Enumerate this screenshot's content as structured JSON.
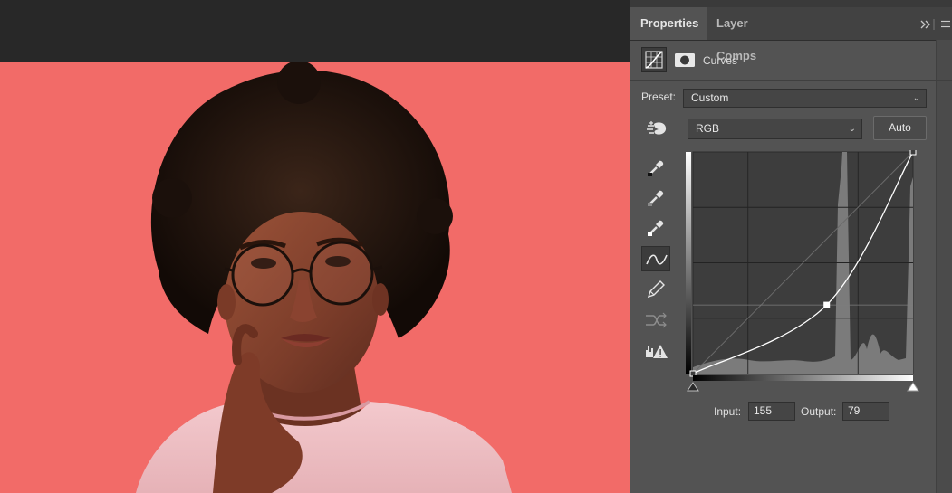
{
  "tabs": [
    {
      "label": "Properties",
      "active": true
    },
    {
      "label": "Layer Comps",
      "active": false
    }
  ],
  "panel": {
    "title": "Curves",
    "preset_label": "Preset:",
    "preset_value": "Custom",
    "channel_value": "RGB",
    "auto_label": "Auto",
    "input_label": "Input:",
    "input_value": "155",
    "output_label": "Output:",
    "output_value": "79"
  },
  "icons": {
    "tab_collapse": "double-chevron-right-icon",
    "tab_menu": "hamburger-menu-icon",
    "adjustment": "curves-adjustment-icon",
    "mask": "layer-mask-icon",
    "on_image": "on-image-adjust-icon",
    "black_point": "black-point-eyedropper-icon",
    "gray_point": "gray-point-eyedropper-icon",
    "white_point": "white-point-eyedropper-icon",
    "edit_points": "edit-points-curve-icon",
    "draw_curve": "pencil-icon",
    "smooth": "smooth-curve-icon",
    "clipping": "clipping-warning-icon"
  },
  "curve": {
    "points": [
      [
        0,
        0
      ],
      [
        155,
        79
      ],
      [
        255,
        255
      ]
    ],
    "active_point": [
      155,
      79
    ]
  },
  "colors": {
    "canvas_background": "#f26b68",
    "panel": "#535353"
  }
}
